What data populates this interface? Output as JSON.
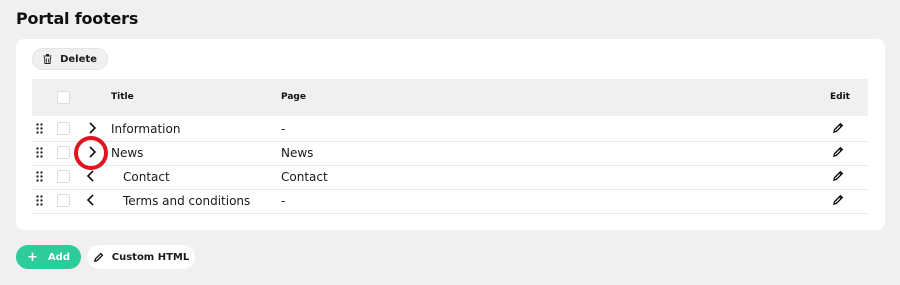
{
  "page": {
    "title": "Portal footers"
  },
  "toolbar": {
    "delete_label": "Delete"
  },
  "table": {
    "columns": {
      "title": "Title",
      "page": "Page",
      "edit": "Edit"
    },
    "rows": [
      {
        "title": "Information",
        "page": "-",
        "chevron": "chevron-right-icon",
        "indent": 0
      },
      {
        "title": "News",
        "page": "News",
        "chevron": "chevron-right-icon",
        "indent": 0
      },
      {
        "title": "Contact",
        "page": "Contact",
        "chevron": "chevron-left-icon",
        "indent": 1
      },
      {
        "title": "Terms and conditions",
        "page": "-",
        "chevron": "chevron-left-icon",
        "indent": 1
      }
    ]
  },
  "footer": {
    "add_label": "Add",
    "add_symbol": "+",
    "custom_html_label": "Custom HTML"
  },
  "colors": {
    "accent": "#2ecc9b",
    "highlight": "#e0141e",
    "background": "#f0f0f1"
  }
}
